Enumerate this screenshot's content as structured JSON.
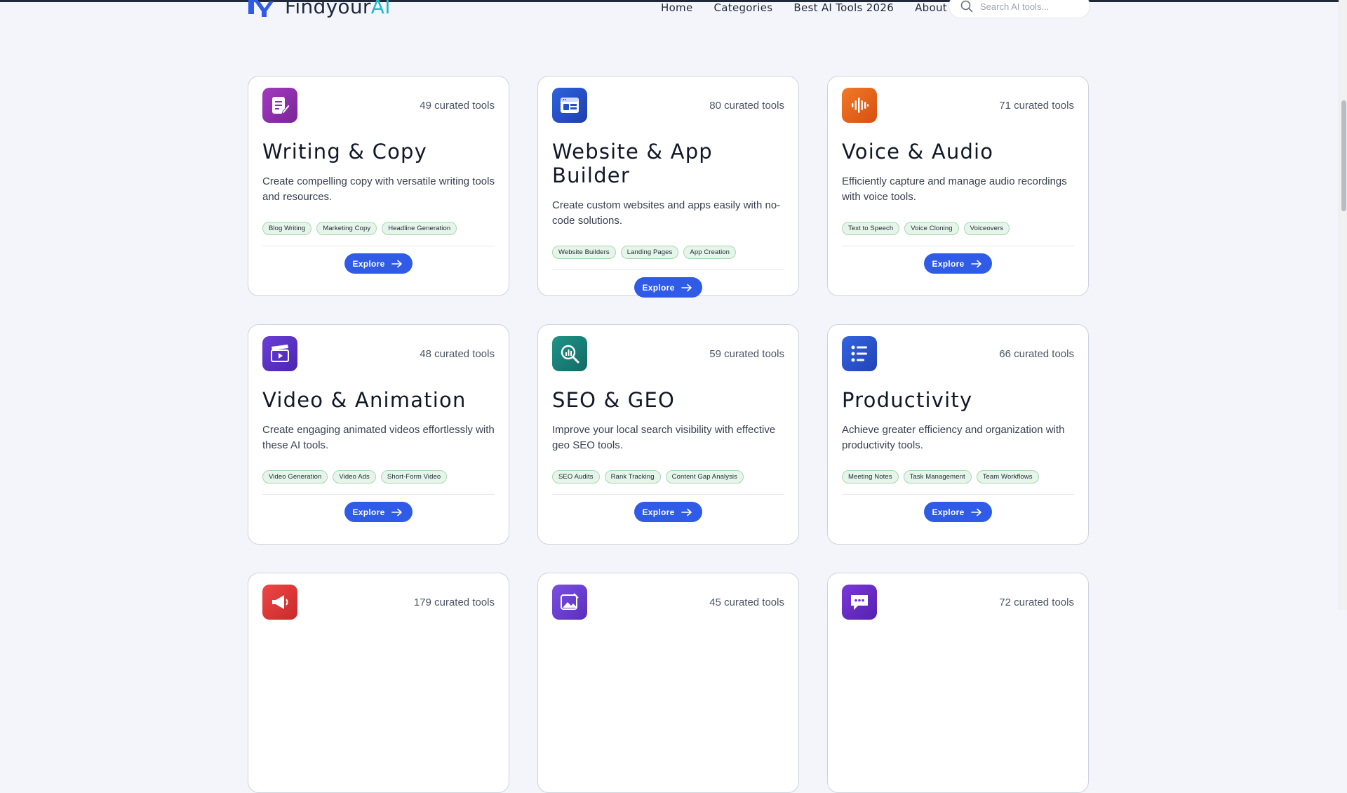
{
  "brand": {
    "name": "Findyour",
    "suffix": "AI"
  },
  "nav": [
    {
      "label": "Home"
    },
    {
      "label": "Categories"
    },
    {
      "label": "Best AI Tools 2026"
    },
    {
      "label": "About"
    }
  ],
  "search": {
    "placeholder": "Search AI tools..."
  },
  "colors": {
    "accent": "#2f5be7",
    "tag_bg": "#e6f5e9",
    "brand_ai": "#22b8cf"
  },
  "cards": [
    {
      "icon": "writing-icon",
      "icon_color": "#8e2fae",
      "count": "49 curated tools",
      "title": "Writing & Copy",
      "desc": "Create compelling copy with versatile writing tools and resources.",
      "tags": [
        "Blog Writing",
        "Marketing Copy",
        "Headline Generation"
      ],
      "button": "Explore"
    },
    {
      "icon": "website-icon",
      "icon_color": "#2450c9",
      "count": "80 curated tools",
      "title": "Website & App Builder",
      "desc": "Create custom websites and apps easily with no-code solutions.",
      "tags": [
        "Website Builders",
        "Landing Pages",
        "App Creation"
      ],
      "button": "Explore"
    },
    {
      "icon": "audio-wave-icon",
      "icon_color": "#e8621c",
      "count": "71 curated tools",
      "title": "Voice & Audio",
      "desc": "Efficiently capture and manage audio recordings with voice tools.",
      "tags": [
        "Text to Speech",
        "Voice Cloning",
        "Voiceovers"
      ],
      "button": "Explore"
    },
    {
      "icon": "clapperboard-icon",
      "icon_color": "#5b34c7",
      "count": "48 curated tools",
      "title": "Video & Animation",
      "desc": "Create engaging animated videos effortlessly with these AI tools.",
      "tags": [
        "Video Generation",
        "Video Ads",
        "Short-Form Video"
      ],
      "button": "Explore"
    },
    {
      "icon": "seo-search-icon",
      "icon_color": "#167e77",
      "count": "59 curated tools",
      "title": "SEO & GEO",
      "desc": "Improve your local search visibility with effective geo SEO tools.",
      "tags": [
        "SEO Audits",
        "Rank Tracking",
        "Content Gap Analysis"
      ],
      "button": "Explore"
    },
    {
      "icon": "checklist-icon",
      "icon_color": "#2d55d4",
      "count": "66 curated tools",
      "title": "Productivity",
      "desc": "Achieve greater efficiency and organization with productivity tools.",
      "tags": [
        "Meeting Notes",
        "Task Management",
        "Team Workflows"
      ],
      "button": "Explore"
    },
    {
      "icon": "megaphone-icon",
      "icon_color": "#e03131",
      "count": "179 curated tools",
      "title": "",
      "desc": "",
      "tags": [],
      "button": ""
    },
    {
      "icon": "image-edit-icon",
      "icon_color": "#6c3fd1",
      "count": "45 curated tools",
      "title": "",
      "desc": "",
      "tags": [],
      "button": ""
    },
    {
      "icon": "chat-bubble-icon",
      "icon_color": "#6a2fc4",
      "count": "72 curated tools",
      "title": "",
      "desc": "",
      "tags": [],
      "button": ""
    }
  ]
}
